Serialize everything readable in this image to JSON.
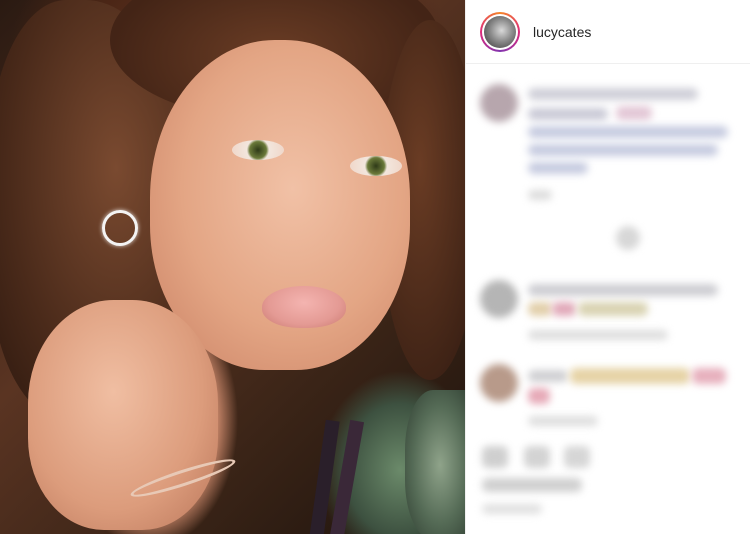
{
  "post": {
    "username": "lucycates",
    "photo_alt": "selfie",
    "icons": {
      "avatar": "profile-avatar"
    }
  },
  "colors": {
    "username_text": "#262626",
    "story_ring": [
      "#f58529",
      "#dd2a7b",
      "#8134af"
    ],
    "divider": "#efefef"
  }
}
